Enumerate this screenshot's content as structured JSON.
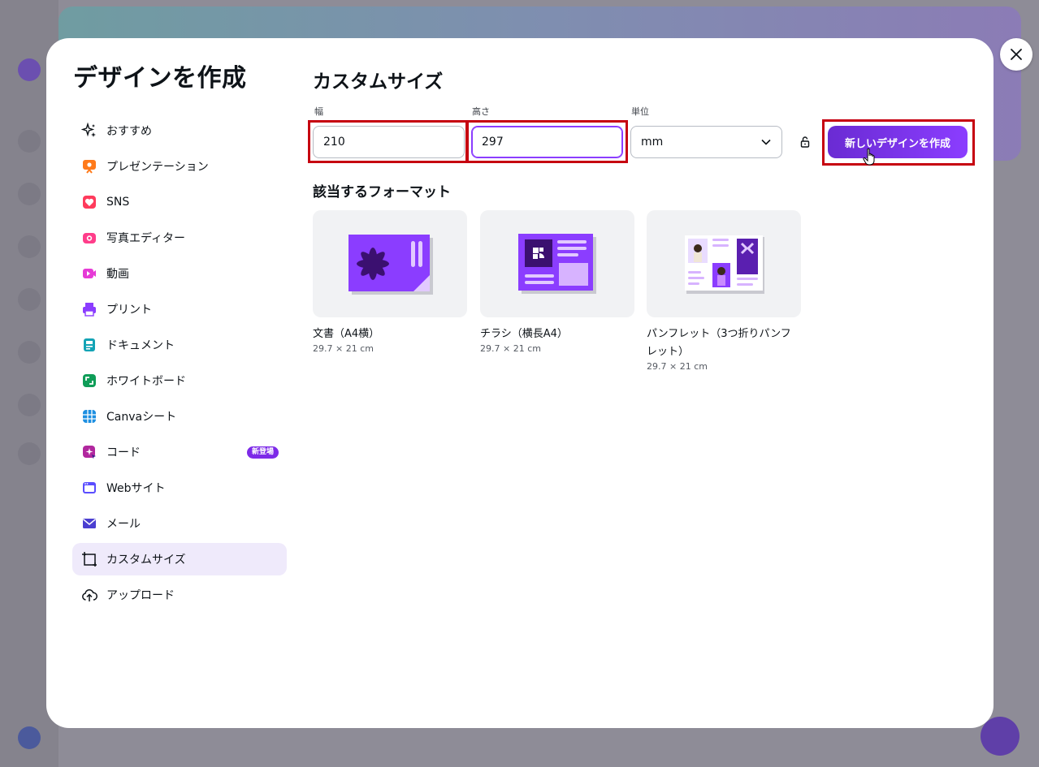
{
  "modal": {
    "title": "デザインを作成",
    "section_title": "カスタムサイズ"
  },
  "nav": {
    "items": [
      {
        "label": "おすすめ",
        "icon": "sparkle-icon"
      },
      {
        "label": "プレゼンテーション",
        "icon": "presentation-icon"
      },
      {
        "label": "SNS",
        "icon": "heart-icon"
      },
      {
        "label": "写真エディター",
        "icon": "camera-icon"
      },
      {
        "label": "動画",
        "icon": "video-icon"
      },
      {
        "label": "プリント",
        "icon": "printer-icon"
      },
      {
        "label": "ドキュメント",
        "icon": "document-icon"
      },
      {
        "label": "ホワイトボード",
        "icon": "whiteboard-icon"
      },
      {
        "label": "Canvaシート",
        "icon": "sheet-icon"
      },
      {
        "label": "コード",
        "icon": "code-icon",
        "badge": "新登場"
      },
      {
        "label": "Webサイト",
        "icon": "website-icon"
      },
      {
        "label": "メール",
        "icon": "mail-icon"
      },
      {
        "label": "カスタムサイズ",
        "icon": "custom-size-icon",
        "active": true
      },
      {
        "label": "アップロード",
        "icon": "upload-cloud-icon"
      }
    ]
  },
  "custom": {
    "width_label": "幅",
    "width_value": "210",
    "height_label": "高さ",
    "height_value": "297",
    "unit_label": "単位",
    "unit_value": "mm",
    "create_button": "新しいデザインを作成"
  },
  "formats": {
    "title": "該当するフォーマット",
    "items": [
      {
        "name": "文書（A4横）",
        "size": "29.7 × 21 cm"
      },
      {
        "name": "チラシ（横長A4）",
        "size": "29.7 × 21 cm"
      },
      {
        "name": "パンフレット（3つ折りパンフレット）",
        "size": "29.7 × 21 cm"
      }
    ]
  },
  "colors": {
    "accent": "#8b3dff",
    "highlight": "#c60010",
    "active_bg": "#efeafb"
  }
}
